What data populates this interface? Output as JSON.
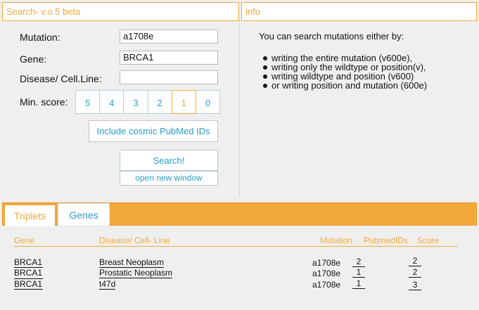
{
  "search_panel": {
    "title": "Search- v.o.5 beta"
  },
  "info_panel": {
    "title": "info",
    "intro": "You can search mutations either by:",
    "items": [
      "writing the entire mutation (v600e),",
      "writing only the wildtype or position(v),",
      "writing wildtype and position (v600)",
      "or writing position and mutation (600e)"
    ]
  },
  "form": {
    "mutation_label": "Mutation:",
    "mutation_value": "a1708e",
    "gene_label": "Gene:",
    "gene_value": "BRCA1",
    "disease_label": "Disease/ Cell.Line:",
    "disease_value": "",
    "min_score_label": "Min. score:",
    "scores": [
      "5",
      "4",
      "3",
      "2",
      "1",
      "0"
    ],
    "selected_score": "1",
    "cosmic_button": "Include cosmic PubMed IDs",
    "search_button": "Search!",
    "new_window_button": "open new window"
  },
  "tabs": [
    {
      "label": "Triplets",
      "active": true
    },
    {
      "label": "Genes",
      "active": false
    }
  ],
  "results": {
    "columns": {
      "gene": "Gene",
      "disease": "Disease/ Cell- Line",
      "mutation": "Mutation",
      "pubmed": "PubmedIDs",
      "score": "Score"
    },
    "rows": [
      {
        "gene": "BRCA1",
        "disease": "Breast Neoplasm",
        "mutation": "a1708e",
        "pubmed": "2",
        "score": "2"
      },
      {
        "gene": "BRCA1",
        "disease": "Prostatic Neoplasm",
        "mutation": "a1708e",
        "pubmed": "1",
        "score": "2"
      },
      {
        "gene": "BRCA1",
        "disease": "t47d",
        "mutation": "a1708e",
        "pubmed": "1",
        "score": "3"
      }
    ]
  },
  "colors": {
    "accent": "#f3a93a",
    "link": "#2a9fc9"
  }
}
